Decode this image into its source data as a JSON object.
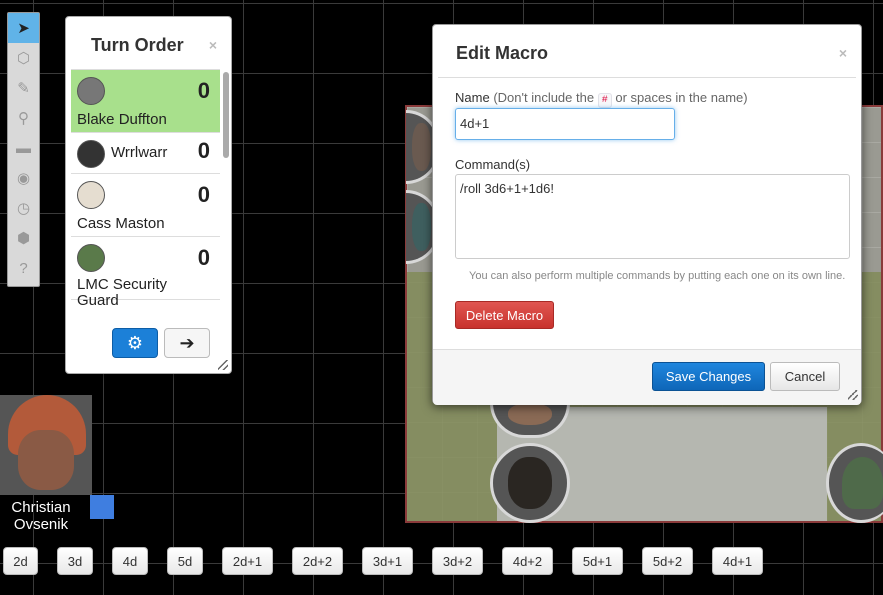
{
  "toolbar": {
    "tools": [
      {
        "name": "select",
        "icon": "cursor-icon",
        "glyph": "➤",
        "active": true
      },
      {
        "name": "shape",
        "icon": "cube-icon",
        "glyph": "⬡"
      },
      {
        "name": "draw",
        "icon": "brush-icon",
        "glyph": "✎"
      },
      {
        "name": "zoom",
        "icon": "magnifier-icon",
        "glyph": "⚲"
      },
      {
        "name": "measure",
        "icon": "ruler-icon",
        "glyph": "▬"
      },
      {
        "name": "fog",
        "icon": "eye-icon",
        "glyph": "◉"
      },
      {
        "name": "turn",
        "icon": "clock-icon",
        "glyph": "◷"
      },
      {
        "name": "dice",
        "icon": "dice-icon",
        "glyph": "⬢"
      },
      {
        "name": "help",
        "icon": "help-icon",
        "glyph": "?"
      }
    ]
  },
  "turn_order": {
    "title": "Turn Order",
    "close": "×",
    "entries": [
      {
        "name": "Blake Duffton",
        "initiative": "0"
      },
      {
        "name": "Wrrlwarr",
        "initiative": "0"
      },
      {
        "name": "Cass Maston",
        "initiative": "0"
      },
      {
        "name": "LMC Security Guard",
        "initiative": "0"
      }
    ],
    "gear_glyph": "⚙",
    "next_glyph": "➔"
  },
  "edit_macro": {
    "title": "Edit Macro",
    "close": "×",
    "name_label": "Name",
    "name_hint_prefix": "(Don't include the",
    "name_hint_code": "#",
    "name_hint_suffix": "or spaces in the name)",
    "name_value": "4d+1",
    "command_label": "Command(s)",
    "command_value": "/roll 3d6+1+1d6!",
    "help_text": "You can also perform multiple commands by putting each one on its own line.",
    "delete_label": "Delete Macro",
    "save_label": "Save Changes",
    "cancel_label": "Cancel"
  },
  "player": {
    "name": "Christian Ovsenik",
    "color": "#3f7ee0"
  },
  "macro_bar": [
    "2d",
    "3d",
    "4d",
    "5d",
    "2d+1",
    "2d+2",
    "3d+1",
    "3d+2",
    "4d+2",
    "5d+1",
    "5d+2",
    "4d+1"
  ]
}
